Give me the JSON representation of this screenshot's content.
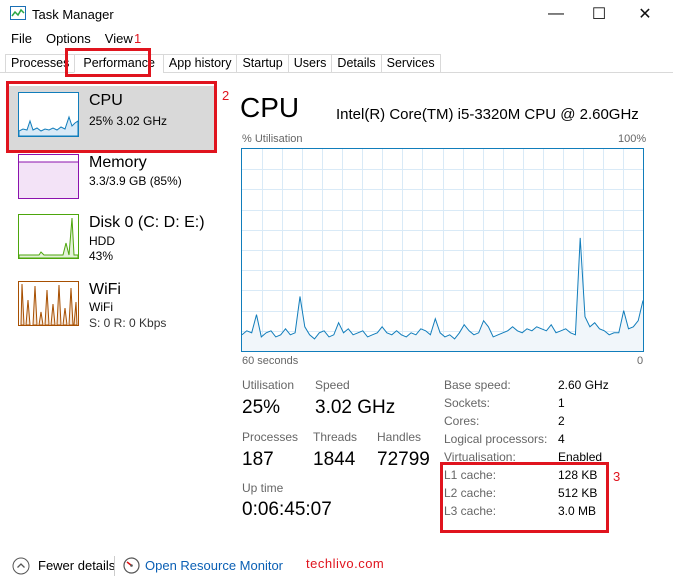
{
  "window": {
    "title": "Task Manager",
    "minimize_glyph": "—",
    "maximize_glyph": "☐",
    "close_glyph": "✕"
  },
  "menu": {
    "items": [
      "File",
      "Options",
      "View"
    ]
  },
  "tabs": [
    "Processes",
    "Performance",
    "App history",
    "Startup",
    "Users",
    "Details",
    "Services"
  ],
  "active_tab": "Performance",
  "annotations": {
    "n1": "1",
    "n2": "2",
    "n3": "3"
  },
  "sidebar": {
    "cpu": {
      "name": "CPU",
      "detail": "25%  3.02 GHz",
      "color": "#117dbb"
    },
    "memory": {
      "name": "Memory",
      "detail": "3.3/3.9 GB (85%)",
      "color": "#8b12ae"
    },
    "disk": {
      "name": "Disk 0 (C: D: E:)",
      "type": "HDD",
      "value": "43%",
      "color": "#4da60c"
    },
    "wifi": {
      "name": "WiFi",
      "type": "WiFi",
      "detail": "S: 0  R: 0 Kbps",
      "color": "#a74f01"
    }
  },
  "main": {
    "title": "CPU",
    "model": "Intel(R) Core(TM) i5-3320M CPU @ 2.60GHz",
    "graph_label": "% Utilisation",
    "graph_max": "100%",
    "graph_span": "60 seconds",
    "graph_min": "0",
    "utilisation_history": [
      8,
      10,
      9,
      18,
      7,
      9,
      10,
      7,
      8,
      11,
      8,
      9,
      27,
      12,
      8,
      6,
      9,
      10,
      7,
      8,
      14,
      9,
      11,
      8,
      9,
      10,
      7,
      8,
      9,
      12,
      9,
      8,
      10,
      8,
      7,
      9,
      8,
      11,
      10,
      8,
      16,
      9,
      7,
      8,
      6,
      9,
      13,
      10,
      8,
      9,
      15,
      12,
      7,
      8,
      9,
      10,
      12,
      10,
      9,
      11,
      10,
      12,
      11,
      10,
      13,
      9,
      10,
      11,
      9,
      8,
      56,
      17,
      12,
      14,
      11,
      10,
      8,
      9,
      9,
      20,
      11,
      12,
      15,
      25
    ]
  },
  "stats": {
    "utilisation": {
      "label": "Utilisation",
      "value": "25%"
    },
    "speed": {
      "label": "Speed",
      "value": "3.02 GHz"
    },
    "processes": {
      "label": "Processes",
      "value": "187"
    },
    "threads": {
      "label": "Threads",
      "value": "1844"
    },
    "handles": {
      "label": "Handles",
      "value": "72799"
    },
    "uptime": {
      "label": "Up time",
      "value": "0:06:45:07"
    }
  },
  "specs": [
    {
      "label": "Base speed:",
      "value": "2.60 GHz"
    },
    {
      "label": "Sockets:",
      "value": "1"
    },
    {
      "label": "Cores:",
      "value": "2"
    },
    {
      "label": "Logical processors:",
      "value": "4"
    },
    {
      "label": "Virtualisation:",
      "value": "Enabled"
    },
    {
      "label": "L1 cache:",
      "value": "128 KB"
    },
    {
      "label": "L2 cache:",
      "value": "512 KB"
    },
    {
      "label": "L3 cache:",
      "value": "3.0 MB"
    }
  ],
  "footer": {
    "fewer_details": "Fewer details",
    "resource_monitor": "Open Resource Monitor",
    "brand": "techlivo.com"
  }
}
